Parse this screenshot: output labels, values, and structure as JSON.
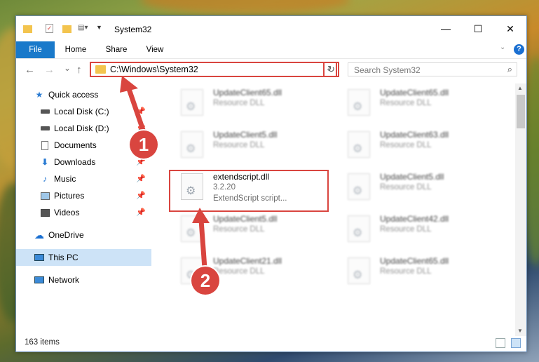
{
  "window": {
    "title": "System32",
    "quick_access_toolbar": [
      "folder-icon",
      "properties-icon",
      "new-folder-icon",
      "customize-icon"
    ],
    "controls": {
      "minimize": "—",
      "maximize": "☐",
      "close": "✕"
    }
  },
  "ribbon": {
    "tabs": [
      {
        "label": "File",
        "active": true
      },
      {
        "label": "Home"
      },
      {
        "label": "Share"
      },
      {
        "label": "View"
      }
    ],
    "help": "?"
  },
  "navbar": {
    "back": "←",
    "forward": "→",
    "recent": "⌄",
    "up": "↑",
    "address": "C:\\Windows\\System32",
    "refresh": "↻",
    "search_placeholder": "Search System32"
  },
  "sidebar": {
    "items": [
      {
        "label": "Quick access",
        "icon": "star-icon"
      },
      {
        "label": "Local Disk (C:)",
        "icon": "drive-icon",
        "pinned": true
      },
      {
        "label": "Local Disk (D:)",
        "icon": "drive-icon",
        "pinned": true
      },
      {
        "label": "Documents",
        "icon": "documents-icon",
        "pinned": true
      },
      {
        "label": "Downloads",
        "icon": "download-icon",
        "pinned": true
      },
      {
        "label": "Music",
        "icon": "music-icon",
        "pinned": true
      },
      {
        "label": "Pictures",
        "icon": "pictures-icon",
        "pinned": true
      },
      {
        "label": "Videos",
        "icon": "videos-icon",
        "pinned": true
      },
      {
        "label": "OneDrive",
        "icon": "cloud-icon"
      },
      {
        "label": "This PC",
        "icon": "computer-icon",
        "selected": true
      },
      {
        "label": "Network",
        "icon": "network-icon"
      }
    ]
  },
  "files": [
    {
      "name": "UpdateClient65.dll",
      "type": "Resource DLL"
    },
    {
      "name": "UpdateClient65.dll",
      "type": "Resource DLL"
    },
    {
      "name": "UpdateClient5.dll",
      "type": "Resource DLL"
    },
    {
      "name": "UpdateClient63.dll",
      "type": "Resource DLL"
    },
    {
      "name": "extendscript.dll",
      "version": "3.2.20",
      "description": "ExtendScript script...",
      "highlighted": true
    },
    {
      "name": "UpdateClient5.dll",
      "type": "Resource DLL"
    },
    {
      "name": "UpdateClient5.dll",
      "type": "Resource DLL"
    },
    {
      "name": "UpdateClient42.dll",
      "type": "Resource DLL"
    },
    {
      "name": "UpdateClient21.dll",
      "type": "Resource DLL"
    },
    {
      "name": "UpdateClient65.dll",
      "type": "Resource DLL"
    }
  ],
  "status": {
    "item_count": "163 items"
  },
  "callouts": [
    "1",
    "2"
  ],
  "colors": {
    "accent": "#1979ca",
    "highlight": "#d9453f",
    "selected": "#cde3f7"
  }
}
